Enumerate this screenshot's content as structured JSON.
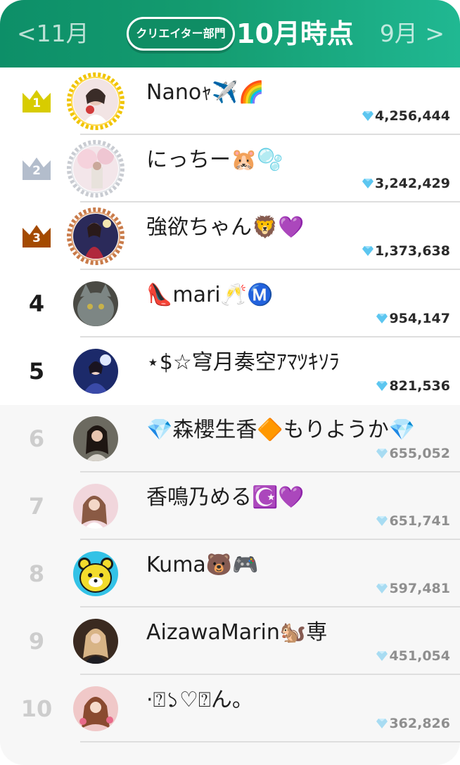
{
  "header": {
    "prev_label": "<11月",
    "next_label": "9月 >",
    "category_label": "クリエイター部門",
    "period_title": "10月時点"
  },
  "colors": {
    "header_gradient_start": "#0d8f68",
    "header_gradient_end": "#20b892",
    "gold": "#d8cc00",
    "silver": "#b3bdcc",
    "bronze": "#a44a00",
    "gem": "#5cc6f0"
  },
  "ranking": [
    {
      "rank": "1",
      "name": "Nanoｬ✈️🌈",
      "score": "4,256,444",
      "badge": "gold-crown"
    },
    {
      "rank": "2",
      "name": "にっちー🐹🫧",
      "score": "3,242,429",
      "badge": "silver-crown"
    },
    {
      "rank": "3",
      "name": "強欲ちゃん🦁💜",
      "score": "1,373,638",
      "badge": "bronze-crown"
    },
    {
      "rank": "4",
      "name": "👠mari🥂Ⓜ️",
      "score": "954,147"
    },
    {
      "rank": "5",
      "name": "⋆$☆穹月奏空ｱﾏﾂｷｿﾗ",
      "score": "821,536"
    },
    {
      "rank": "6",
      "name": "💎森櫻生香🔶もりようか💎",
      "score": "655,052"
    },
    {
      "rank": "7",
      "name": "香鳴乃める☪️💜",
      "score": "651,741"
    },
    {
      "rank": "8",
      "name": "Kuma🐻🎮",
      "score": "597,481"
    },
    {
      "rank": "9",
      "name": "AizawaMarin🐿️専",
      "score": "451,054"
    },
    {
      "rank": "10",
      "name": "·⍰১♡⍰ん。",
      "score": "362,826"
    }
  ]
}
